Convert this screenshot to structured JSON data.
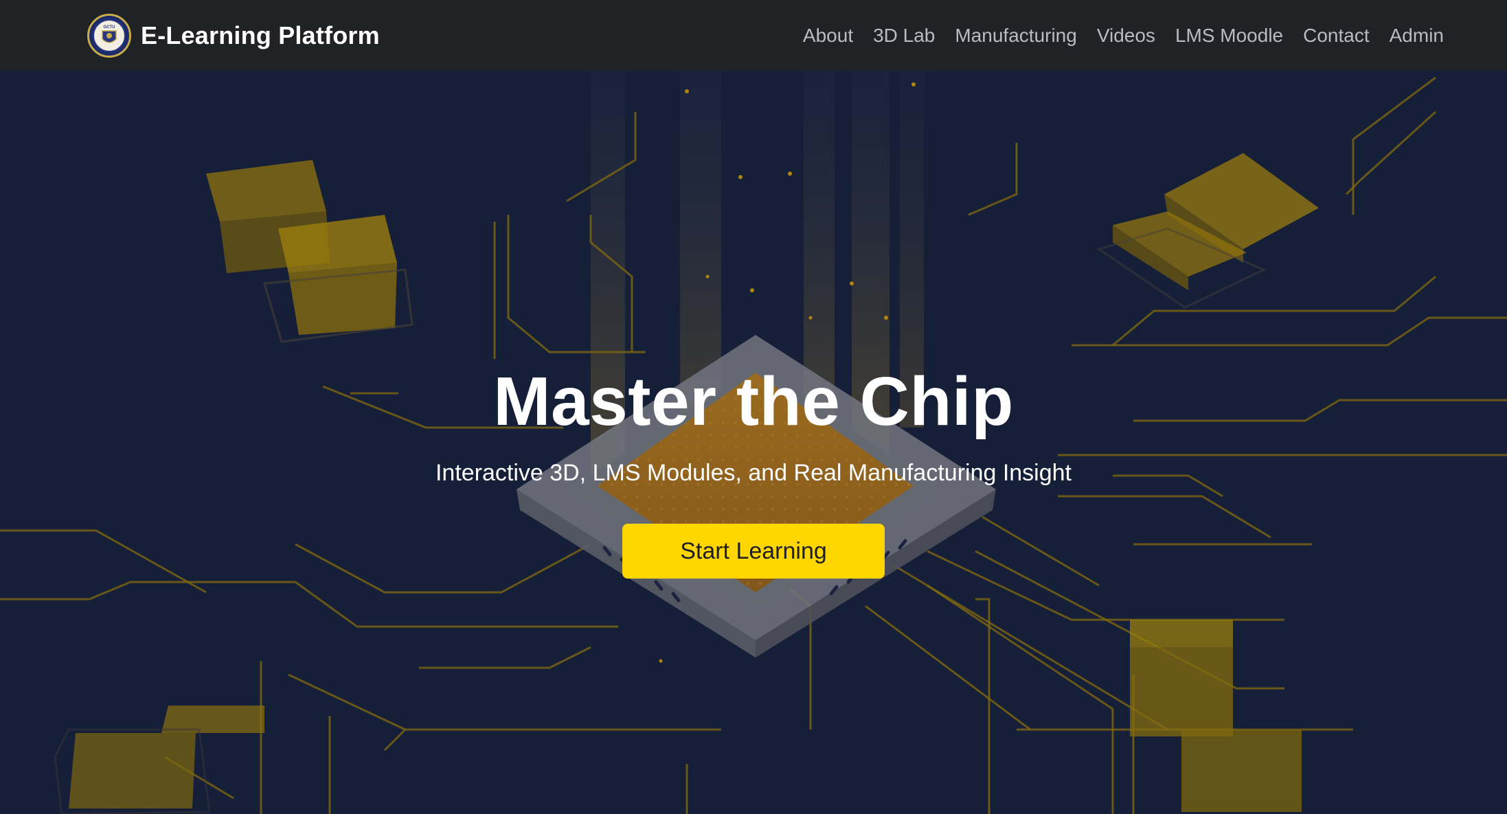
{
  "brand": {
    "name": "E-Learning Platform",
    "logo_text": "GCTU",
    "logo_icon": "university-crest-icon"
  },
  "nav": {
    "items": [
      {
        "label": "About"
      },
      {
        "label": "3D Lab"
      },
      {
        "label": "Manufacturing"
      },
      {
        "label": "Videos"
      },
      {
        "label": "LMS Moodle"
      },
      {
        "label": "Contact"
      },
      {
        "label": "Admin"
      }
    ]
  },
  "hero": {
    "title": "Master the Chip",
    "subtitle": "Interactive 3D, LMS Modules, and Real Manufacturing Insight",
    "cta_label": "Start Learning",
    "background_icon": "circuit-chip-illustration"
  },
  "colors": {
    "navbar_bg": "#202226",
    "hero_bg": "#161f38",
    "accent": "#ffd600",
    "circuit_trace": "#c9a100",
    "nav_link": "#b8bcc4"
  }
}
